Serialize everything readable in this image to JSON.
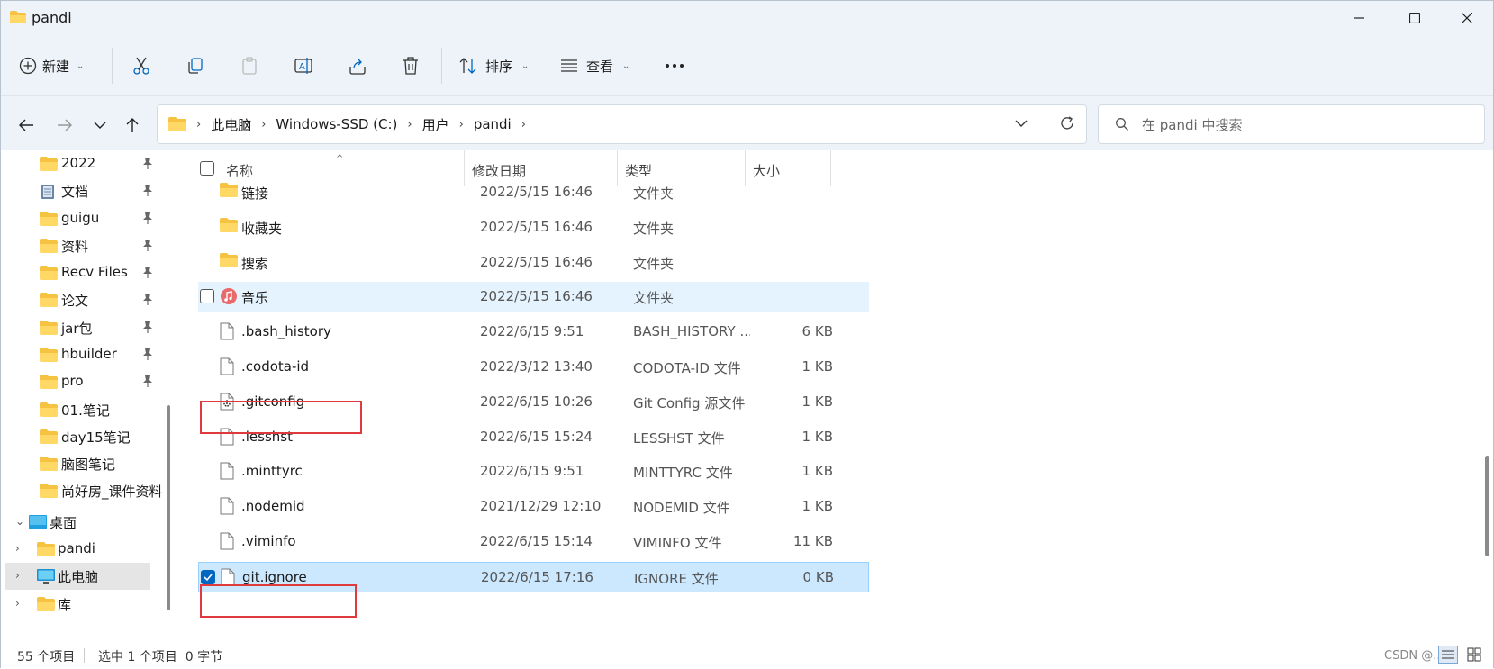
{
  "window": {
    "title": "pandi"
  },
  "toolbar": {
    "new_label": "新建",
    "sort_label": "排序",
    "view_label": "查看"
  },
  "address": {
    "crumbs": [
      "此电脑",
      "Windows-SSD (C:)",
      "用户",
      "pandi"
    ]
  },
  "search": {
    "placeholder": "在 pandi 中搜索"
  },
  "nav": {
    "items": [
      {
        "label": "2022",
        "icon": "folder-icon",
        "pinned": true
      },
      {
        "label": "文档",
        "icon": "documents-icon",
        "pinned": true
      },
      {
        "label": "guigu",
        "icon": "folder-icon",
        "pinned": true
      },
      {
        "label": "资料",
        "icon": "folder-icon",
        "pinned": true
      },
      {
        "label": "Recv Files",
        "icon": "folder-icon",
        "pinned": true
      },
      {
        "label": "论文",
        "icon": "folder-icon",
        "pinned": true
      },
      {
        "label": "jar包",
        "icon": "folder-icon",
        "pinned": true
      },
      {
        "label": "hbuilder",
        "icon": "folder-icon",
        "pinned": true
      },
      {
        "label": "pro",
        "icon": "folder-icon",
        "pinned": true
      },
      {
        "label": "01.笔记",
        "icon": "folder-icon",
        "pinned": false
      },
      {
        "label": "day15笔记",
        "icon": "folder-icon",
        "pinned": false
      },
      {
        "label": "脑图笔记",
        "icon": "folder-icon",
        "pinned": false
      },
      {
        "label": "尚好房_课件资料",
        "icon": "folder-icon",
        "pinned": false
      },
      {
        "label": "桌面",
        "icon": "desktop-icon",
        "pinned": false
      },
      {
        "label": "pandi",
        "icon": "folder-icon",
        "pinned": false
      },
      {
        "label": "此电脑",
        "icon": "computer-icon",
        "pinned": false
      },
      {
        "label": "库",
        "icon": "folder-icon",
        "pinned": false
      }
    ]
  },
  "columns": {
    "name": "名称",
    "date": "修改日期",
    "type": "类型",
    "size": "大小"
  },
  "files": [
    {
      "name": "链接",
      "date": "2022/5/15 16:46",
      "type": "文件夹",
      "size": "",
      "icon": "folder-icon"
    },
    {
      "name": "收藏夹",
      "date": "2022/5/15 16:46",
      "type": "文件夹",
      "size": "",
      "icon": "folder-icon"
    },
    {
      "name": "搜索",
      "date": "2022/5/15 16:46",
      "type": "文件夹",
      "size": "",
      "icon": "folder-icon"
    },
    {
      "name": "音乐",
      "date": "2022/5/15 16:46",
      "type": "文件夹",
      "size": "",
      "icon": "music-folder-icon"
    },
    {
      "name": ".bash_history",
      "date": "2022/6/15 9:51",
      "type": "BASH_HISTORY ...",
      "size": "6 KB",
      "icon": "file-icon"
    },
    {
      "name": ".codota-id",
      "date": "2022/3/12 13:40",
      "type": "CODOTA-ID 文件",
      "size": "1 KB",
      "icon": "file-icon"
    },
    {
      "name": ".gitconfig",
      "date": "2022/6/15 10:26",
      "type": "Git Config 源文件",
      "size": "1 KB",
      "icon": "config-file-icon"
    },
    {
      "name": ".lesshst",
      "date": "2022/6/15 15:24",
      "type": "LESSHST 文件",
      "size": "1 KB",
      "icon": "file-icon"
    },
    {
      "name": ".minttyrc",
      "date": "2022/6/15 9:51",
      "type": "MINTTYRC 文件",
      "size": "1 KB",
      "icon": "file-icon"
    },
    {
      "name": ".nodemid",
      "date": "2021/12/29 12:10",
      "type": "NODEMID 文件",
      "size": "1 KB",
      "icon": "file-icon"
    },
    {
      "name": ".viminfo",
      "date": "2022/6/15 15:14",
      "type": "VIMINFO 文件",
      "size": "11 KB",
      "icon": "file-icon"
    },
    {
      "name": "git.ignore",
      "date": "2022/6/15 17:16",
      "type": "IGNORE 文件",
      "size": "0 KB",
      "icon": "file-icon"
    }
  ],
  "status": {
    "count": "55 个项目",
    "selection": "选中 1 个项目  0 字节"
  },
  "watermark": "CSDN @...",
  "colors": {
    "accent": "#0067c0",
    "selection": "#cce8ff",
    "hover": "#e5f3ff",
    "highlight_box": "#e0393e",
    "folder": "#f5c242"
  }
}
